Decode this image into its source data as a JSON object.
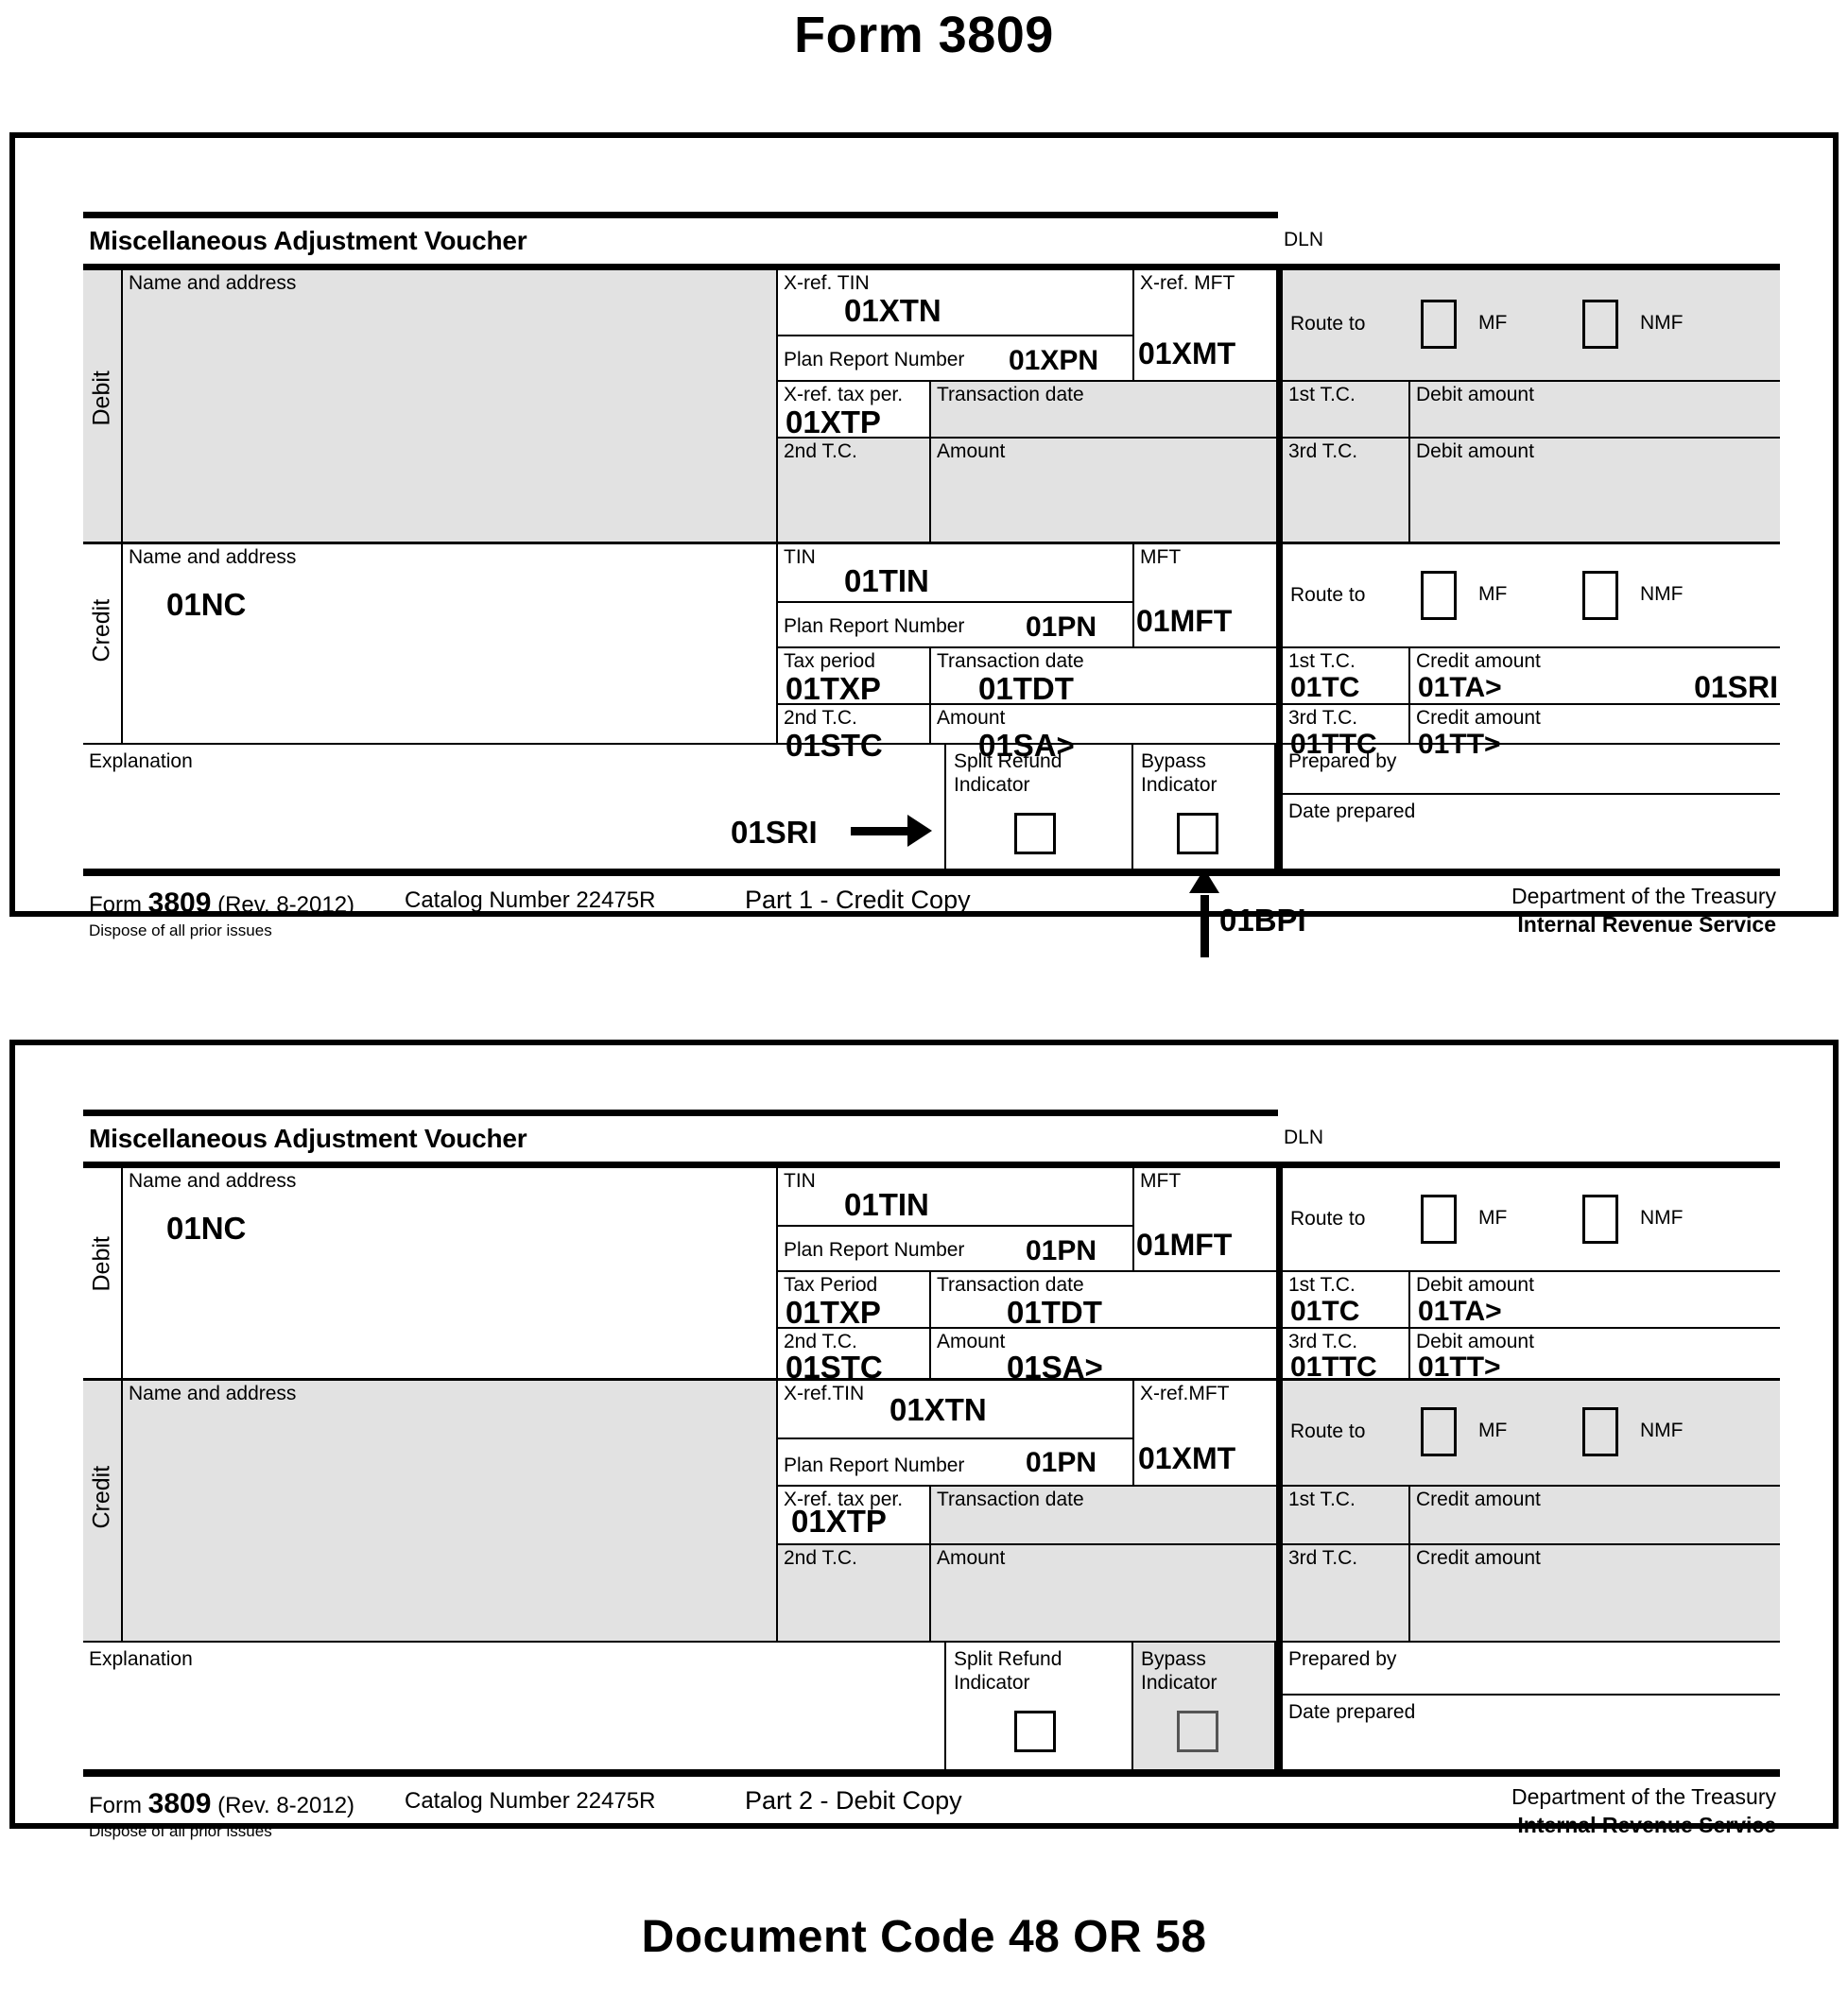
{
  "titles": {
    "top": "Form 3809",
    "bottom": "Document Code 48 OR 58"
  },
  "voucher1": {
    "heading": "Miscellaneous Adjustment Voucher",
    "dln_label": "DLN",
    "debit": {
      "side_label": "Debit",
      "name_address_label": "Name and address",
      "name_address_value": "",
      "tin_label": "X-ref. TIN",
      "tin_value": "01XTN",
      "plan_label": "Plan Report Number",
      "plan_value": "01XPN",
      "mft_label": "X-ref. MFT",
      "mft_value": "01XMT",
      "tax_period_label": "X-ref. tax per.",
      "tax_period_value": "01XTP",
      "trans_date_label": "Transaction date",
      "trans_date_value": "",
      "second_tc_label": "2nd T.C.",
      "second_tc_value": "",
      "amount_label": "Amount",
      "amount_value": "",
      "route_label": "Route to",
      "mf_label": "MF",
      "nmf_label": "NMF",
      "first_tc_label": "1st T.C.",
      "first_tc_value": "",
      "amount1_label": "Debit amount",
      "amount1_value": "",
      "third_tc_label": "3rd T.C.",
      "third_tc_value": "",
      "amount2_label": "Debit amount",
      "amount2_value": ""
    },
    "credit": {
      "side_label": "Credit",
      "name_address_label": "Name and address",
      "name_address_value": "01NC",
      "tin_label": "TIN",
      "tin_value": "01TIN",
      "plan_label": "Plan Report Number",
      "plan_value": "01PN",
      "mft_label": "MFT",
      "mft_value": "01MFT",
      "tax_period_label": "Tax period",
      "tax_period_value": "01TXP",
      "trans_date_label": "Transaction date",
      "trans_date_value": "01TDT",
      "second_tc_label": "2nd T.C.",
      "second_tc_value": "01STC",
      "amount_label": "Amount",
      "amount_value": "01SA>",
      "route_label": "Route to",
      "mf_label": "MF",
      "nmf_label": "NMF",
      "first_tc_label": "1st T.C.",
      "first_tc_value": "01TC",
      "amount1_label": "Credit amount",
      "amount1_value": "01TA>",
      "amount1_extra": "01SRI",
      "third_tc_label": "3rd T.C.",
      "third_tc_value": "01TTC",
      "amount2_label": "Credit amount",
      "amount2_value": "01TT>"
    },
    "bottom_row": {
      "explanation_label": "Explanation",
      "explanation_value": "",
      "split_refund_label_line1": "Split Refund",
      "split_refund_label_line2": "Indicator",
      "bypass_label_line1": "Bypass",
      "bypass_label_line2": "Indicator",
      "prepared_by_label": "Prepared by",
      "date_prepared_label": "Date prepared",
      "split_refund_annotation": "01SRI",
      "bypass_annotation": "01BPI"
    },
    "footer": {
      "form_prefix": "Form ",
      "form_number": "3809",
      "form_rev": " (Rev. 8-2012)",
      "dispose": "Dispose of all prior issues",
      "catalog": "Catalog Number 22475R",
      "part": "Part 1 - Credit Copy",
      "department": "Department of the Treasury",
      "agency": "Internal Revenue Service"
    }
  },
  "voucher2": {
    "heading": "Miscellaneous Adjustment Voucher",
    "dln_label": "DLN",
    "debit": {
      "side_label": "Debit",
      "name_address_label": "Name and address",
      "name_address_value": "01NC",
      "tin_label": "TIN",
      "tin_value": "01TIN",
      "plan_label": "Plan Report Number",
      "plan_value": "01PN",
      "mft_label": "MFT",
      "mft_value": "01MFT",
      "tax_period_label": "Tax Period",
      "tax_period_value": "01TXP",
      "trans_date_label": "Transaction date",
      "trans_date_value": "01TDT",
      "second_tc_label": "2nd T.C.",
      "second_tc_value": "01STC",
      "amount_label": "Amount",
      "amount_value": "01SA>",
      "route_label": "Route to",
      "mf_label": "MF",
      "nmf_label": "NMF",
      "first_tc_label": "1st T.C.",
      "first_tc_value": "01TC",
      "amount1_label": "Debit amount",
      "amount1_value": "01TA>",
      "third_tc_label": "3rd T.C.",
      "third_tc_value": "01TTC",
      "amount2_label": "Debit amount",
      "amount2_value": "01TT>"
    },
    "credit": {
      "side_label": "Credit",
      "name_address_label": "Name and address",
      "name_address_value": "",
      "tin_label": "X-ref.TIN",
      "tin_value": "01XTN",
      "plan_label": "Plan Report Number",
      "plan_value": "01PN",
      "mft_label": "X-ref.MFT",
      "mft_value": "01XMT",
      "tax_period_label": "X-ref. tax per.",
      "tax_period_value": "01XTP",
      "trans_date_label": "Transaction date",
      "trans_date_value": "",
      "second_tc_label": "2nd T.C.",
      "second_tc_value": "",
      "amount_label": "Amount",
      "amount_value": "",
      "route_label": "Route to",
      "mf_label": "MF",
      "nmf_label": "NMF",
      "first_tc_label": "1st T.C.",
      "first_tc_value": "",
      "amount1_label": "Credit amount",
      "amount1_value": "",
      "third_tc_label": "3rd T.C.",
      "third_tc_value": "",
      "amount2_label": "Credit amount",
      "amount2_value": ""
    },
    "bottom_row": {
      "explanation_label": "Explanation",
      "explanation_value": "",
      "split_refund_label_line1": "Split Refund",
      "split_refund_label_line2": "Indicator",
      "bypass_label_line1": "Bypass",
      "bypass_label_line2": "Indicator",
      "prepared_by_label": "Prepared by",
      "date_prepared_label": "Date prepared"
    },
    "footer": {
      "form_prefix": "Form ",
      "form_number": "3809",
      "form_rev": " (Rev. 8-2012)",
      "dispose": "Dispose of all prior issues",
      "catalog": "Catalog Number 22475R",
      "part": "Part 2 - Debit Copy",
      "department": "Department of the Treasury",
      "agency": "Internal Revenue Service"
    }
  },
  "colors": {
    "shaded": "#e2e2e2",
    "line": "#000000",
    "background": "#ffffff"
  }
}
